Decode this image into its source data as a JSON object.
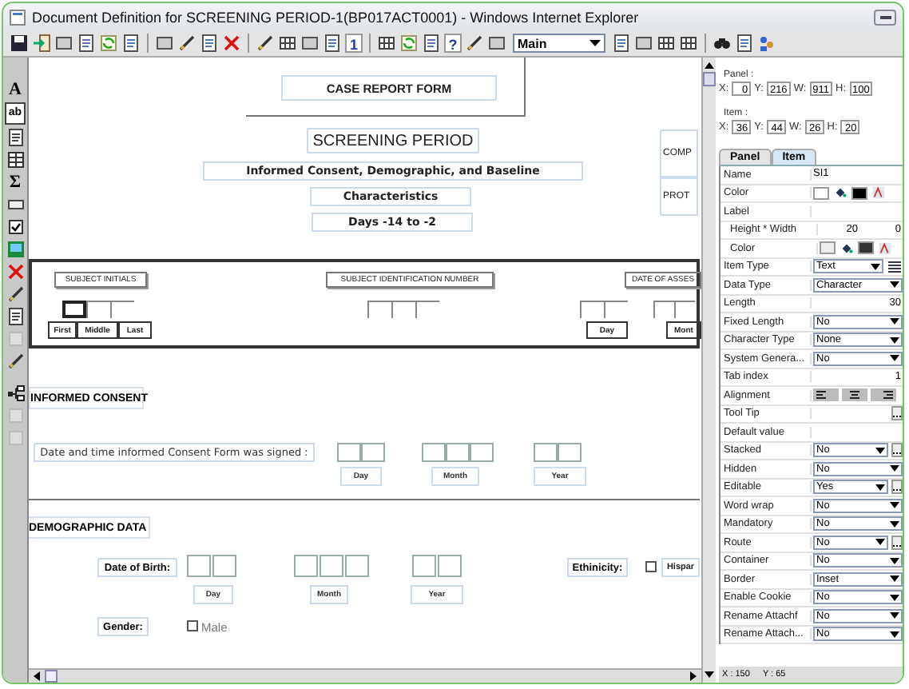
{
  "window": {
    "title": "Document Definition for SCREENING PERIOD-1(BP017ACT0001) - Windows Internet Explorer"
  },
  "toolbar": {
    "page_number_glyph": "1",
    "help_glyph": "?",
    "view_select": {
      "value": "Main"
    }
  },
  "palette": {
    "text_glyph": "A",
    "field_glyph": "ab",
    "sum_glyph": "Σ"
  },
  "form": {
    "header": "CASE REPORT FORM",
    "titles": [
      "SCREENING PERIOD",
      "Informed Consent, Demographic, and Baseline",
      "Characteristics",
      "Days -14 to -2"
    ],
    "side_labels": [
      "COMP",
      "PROT"
    ],
    "subject": [
      {
        "label": "SUBJECT INITIALS",
        "sublabels": [
          "First",
          "Middle",
          "Last"
        ]
      },
      {
        "label": "SUBJECT IDENTIFICATION NUMBER"
      },
      {
        "label": "DATE OF ASSES",
        "sublabels": [
          "Day",
          "Mont"
        ]
      }
    ],
    "consent": {
      "heading": "INFORMED CONSENT",
      "question": "Date and time informed Consent Form was signed :",
      "sublabels": [
        "Day",
        "Month",
        "Year"
      ]
    },
    "demographic": {
      "heading": "DEMOGRAPHIC DATA",
      "dob_label": "Date of Birth:",
      "sublabels": [
        "Day",
        "Month",
        "Year"
      ],
      "ethnicity_label": "Ethinicity:",
      "ethnicity_option": {
        "label": "Hispar",
        "checked": false
      },
      "gender_label": "Gender:",
      "gender_option": {
        "label": "Male",
        "checked": false
      }
    }
  },
  "panel": {
    "panel_geometry": {
      "label": "Panel :",
      "fields": [
        {
          "label": "X:",
          "value": "0"
        },
        {
          "label": "Y:",
          "value": "216"
        },
        {
          "label": "W:",
          "value": "911"
        },
        {
          "label": "H:",
          "value": "100"
        }
      ]
    },
    "item_geometry": {
      "label": "Item :",
      "fields": [
        {
          "label": "X:",
          "value": "36"
        },
        {
          "label": "Y:",
          "value": "44"
        },
        {
          "label": "W:",
          "value": "26"
        },
        {
          "label": "H:",
          "value": "20"
        }
      ]
    },
    "tabs": [
      {
        "label": "Panel",
        "selected": false
      },
      {
        "label": "Item",
        "selected": true
      }
    ],
    "properties": [
      {
        "label": "Name",
        "kind": "text",
        "value": "SI1"
      },
      {
        "label": "Color",
        "kind": "color"
      },
      {
        "label": "Label",
        "kind": "section"
      },
      {
        "label": "Height * Width",
        "kind": "pair",
        "values": [
          "20",
          "0"
        ],
        "indented": true
      },
      {
        "label": "Color",
        "kind": "color",
        "indented": true
      },
      {
        "label": "Item Type",
        "kind": "select",
        "value": "Text",
        "list_icon": true
      },
      {
        "label": "Data Type",
        "kind": "select",
        "value": "Character"
      },
      {
        "label": "Length",
        "kind": "number",
        "value": "30"
      },
      {
        "label": "Fixed Length",
        "kind": "select",
        "value": "No"
      },
      {
        "label": "Character Type",
        "kind": "select",
        "value": "None"
      },
      {
        "label": "System Genera...",
        "kind": "select",
        "value": "No"
      },
      {
        "label": "Tab index",
        "kind": "number",
        "value": "1"
      },
      {
        "label": "Alignment",
        "kind": "align"
      },
      {
        "label": "Tool Tip",
        "kind": "dialog"
      },
      {
        "label": "Default value",
        "kind": "text"
      },
      {
        "label": "Stacked",
        "kind": "select",
        "value": "No",
        "more": true
      },
      {
        "label": "Hidden",
        "kind": "select",
        "value": "No"
      },
      {
        "label": "Editable",
        "kind": "select",
        "value": "Yes",
        "more": true
      },
      {
        "label": "Word wrap",
        "kind": "select",
        "value": "No"
      },
      {
        "label": "Mandatory",
        "kind": "select",
        "value": "No"
      },
      {
        "label": "Route",
        "kind": "select",
        "value": "No",
        "more": true
      },
      {
        "label": "Container",
        "kind": "select",
        "value": "No"
      },
      {
        "label": "Border",
        "kind": "select",
        "value": "Inset"
      },
      {
        "label": "Enable Cookie",
        "kind": "select",
        "value": "No"
      },
      {
        "label": "Rename Attachf",
        "kind": "select",
        "value": "No"
      },
      {
        "label": "Rename Attach...",
        "kind": "select",
        "value": "No"
      }
    ],
    "status": [
      "X : 150",
      "Y : 65"
    ]
  }
}
